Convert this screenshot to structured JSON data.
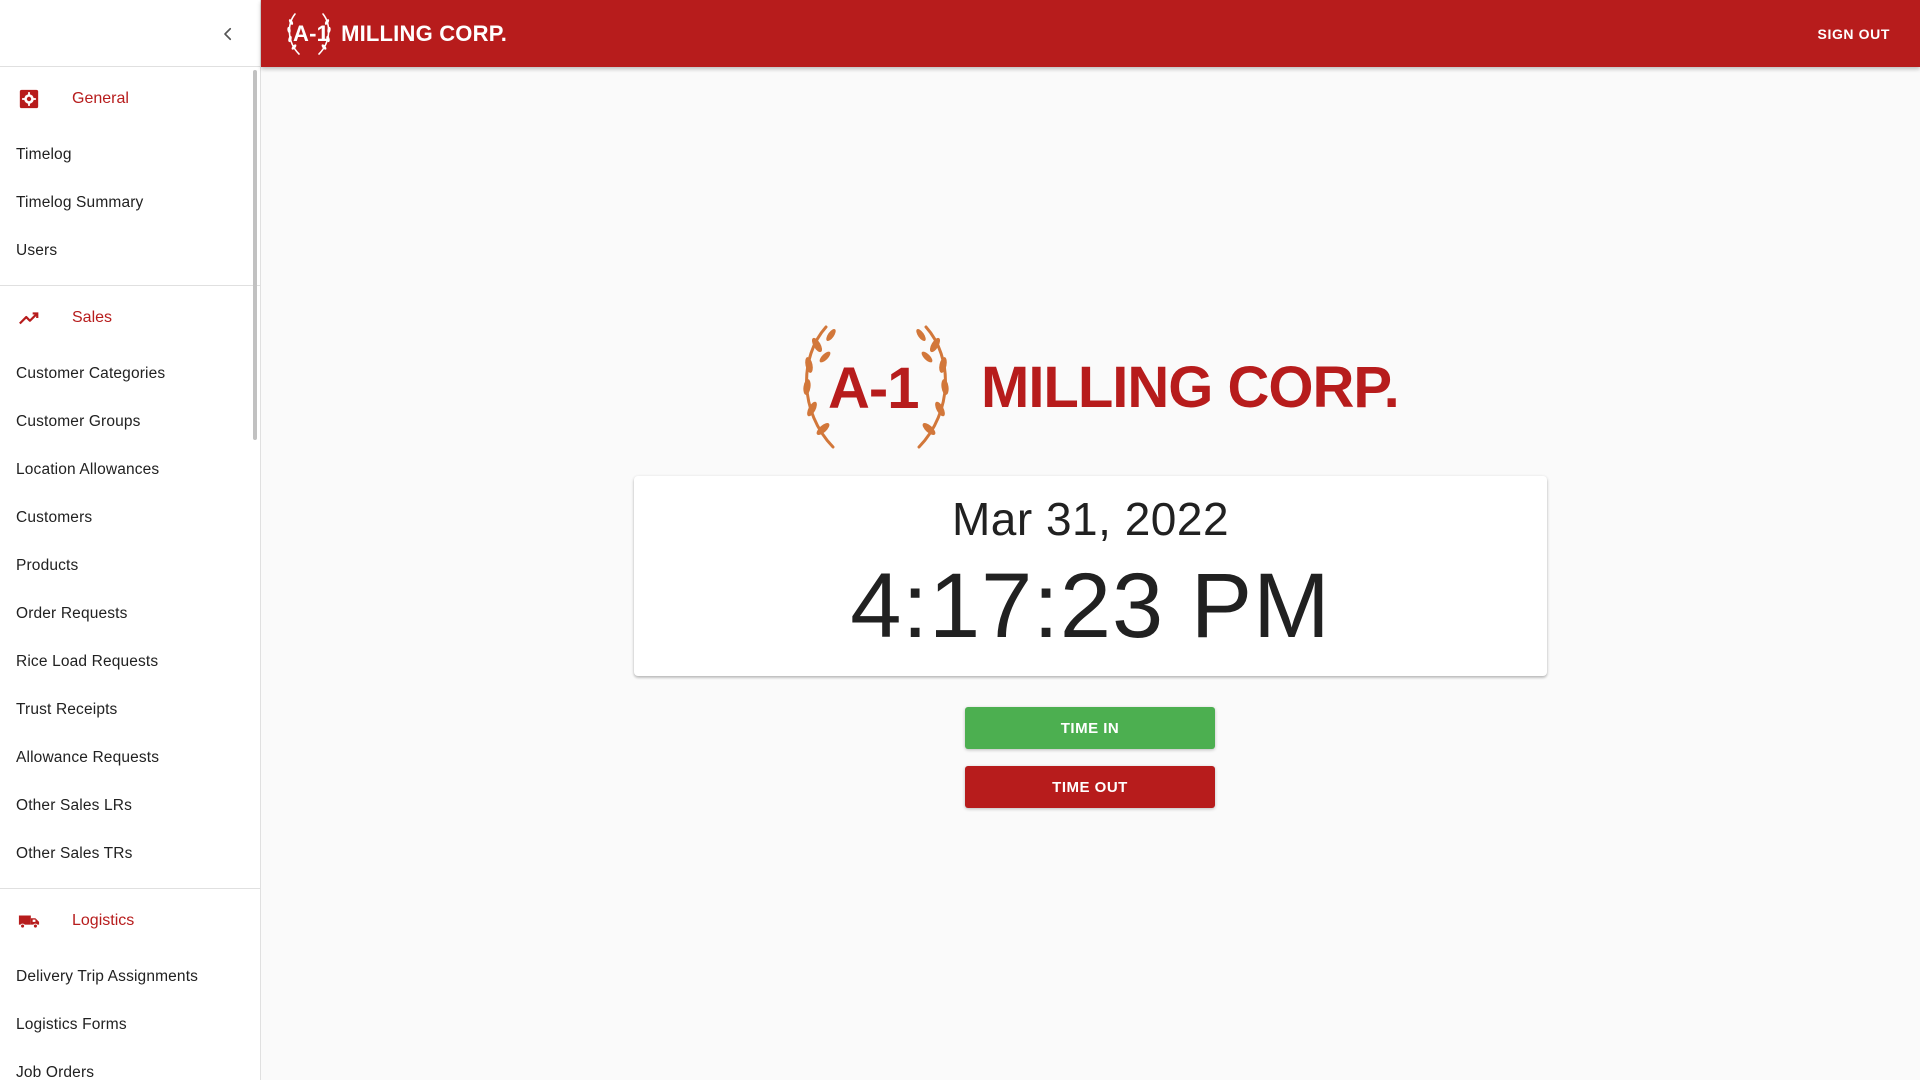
{
  "brand": {
    "prefix": "A-1",
    "name": "MILLING CORP.",
    "primary_color": "#b71c1c",
    "accent_color": "#d2773a"
  },
  "header": {
    "sign_out_label": "SIGN OUT"
  },
  "sidebar": {
    "collapse_icon": "chevron-left-icon",
    "sections": [
      {
        "title": "General",
        "icon": "gear-icon",
        "items": [
          "Timelog",
          "Timelog Summary",
          "Users"
        ]
      },
      {
        "title": "Sales",
        "icon": "trending-up-icon",
        "items": [
          "Customer Categories",
          "Customer Groups",
          "Location Allowances",
          "Customers",
          "Products",
          "Order Requests",
          "Rice Load Requests",
          "Trust Receipts",
          "Allowance Requests",
          "Other Sales LRs",
          "Other Sales TRs"
        ]
      },
      {
        "title": "Logistics",
        "icon": "truck-icon",
        "items": [
          "Delivery Trip Assignments",
          "Logistics Forms",
          "Job Orders"
        ]
      }
    ]
  },
  "clock": {
    "date": "Mar 31, 2022",
    "time": "4:17:23 PM"
  },
  "actions": {
    "time_in_label": "TIME IN",
    "time_in_color": "#4caf50",
    "time_out_label": "TIME OUT",
    "time_out_color": "#b71c1c"
  }
}
